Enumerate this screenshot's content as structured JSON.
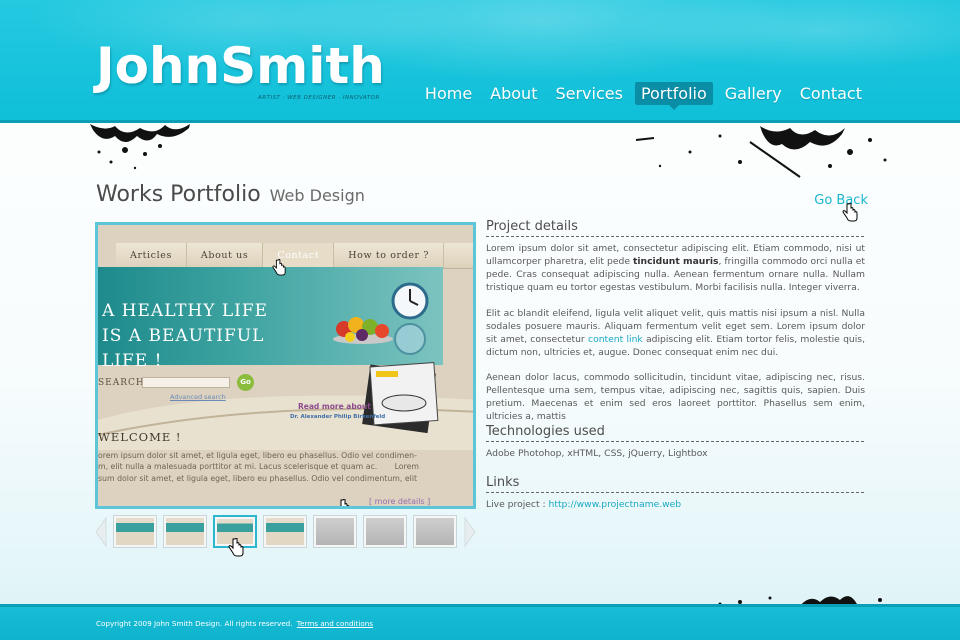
{
  "header": {
    "logo": "JohnSmith",
    "tagline": "ARTIST · WEB DESIGNER · INNOVATOR",
    "nav": [
      {
        "label": "Home",
        "active": false
      },
      {
        "label": "About",
        "active": false
      },
      {
        "label": "Services",
        "active": false
      },
      {
        "label": "Portfolio",
        "active": true
      },
      {
        "label": "Gallery",
        "active": false
      },
      {
        "label": "Contact",
        "active": false
      }
    ]
  },
  "title": {
    "main": "Works Portfolio",
    "sub": "Web Design",
    "go_back": "Go Back"
  },
  "preview": {
    "nav": [
      "Articles",
      "About us",
      "Contact",
      "How to order ?"
    ],
    "banner_line1": "A HEALTHY LIFE",
    "banner_line2": "IS A BEAUTIFUL LIFE !",
    "search_label": "SEARCH",
    "go_label": "Go",
    "advanced_search": "Advanced search",
    "read_more": "Read more about",
    "author": "Dr. Alexander Philip Birkenfeld",
    "welcome": "WELCOME !",
    "body": "orem ipsum dolor sit amet, et ligula eget, libero eu phasellus. Odio vel condimen-\nm, elit nulla a malesuada porttitor at mi. Lacus scelerisque et quam ac.       Lorem\nsum dolor sit amet, et ligula eget, libero eu phasellus. Odio vel condimentum, elit",
    "more_details": "[ more details ]"
  },
  "thumbnails": {
    "count": 7,
    "selected_index": 2,
    "filled": [
      true,
      true,
      true,
      true,
      false,
      false,
      false
    ]
  },
  "project": {
    "heading": "Project details",
    "p1_a": "Lorem ipsum dolor sit amet, consectetur adipiscing elit. Etiam commodo, nisi ut ullamcorper pharetra, elit pede ",
    "p1_bold": "tincidunt mauris",
    "p1_b": ", fringilla commodo orci nulla et pede. Cras consequat adipiscing nulla. Aenean fermentum ornare nulla. Nullam tristique quam eu tortor egestas vestibulum. Morbi facilisis nulla. Integer viverra.",
    "p2_a": "Elit ac blandit eleifend, ligula velit aliquet velit, quis mattis nisi ipsum a nisl. Nulla sodales posuere mauris. Aliquam fermentum velit eget sem. Lorem ipsum dolor sit amet, consectetur ",
    "p2_link": "content link",
    "p2_b": " adipiscing elit. Etiam tortor felis, molestie quis, dictum non, ultricies et, augue. Donec consequat enim nec dui.",
    "p3": "Aenean dolor lacus, commodo sollicitudin, tincidunt vitae, adipiscing nec, risus. Pellentesque urna sem, tempus vitae, adipiscing nec, sagittis quis, sapien. Duis pretium. Maecenas et enim sed eros laoreet porttitor. Phasellus sem enim, ultricies a, mattis"
  },
  "technologies": {
    "heading": "Technologies used",
    "text": "Adobe Photohop, xHTML, CSS, jQuerry, Lightbox"
  },
  "links": {
    "heading": "Links",
    "label": "Live project : ",
    "url": "http://www.projectname.web"
  },
  "footer": {
    "copyright": "Copyright 2009 John Smith Design. All rights reserved.",
    "terms": "Terms and conditions"
  }
}
